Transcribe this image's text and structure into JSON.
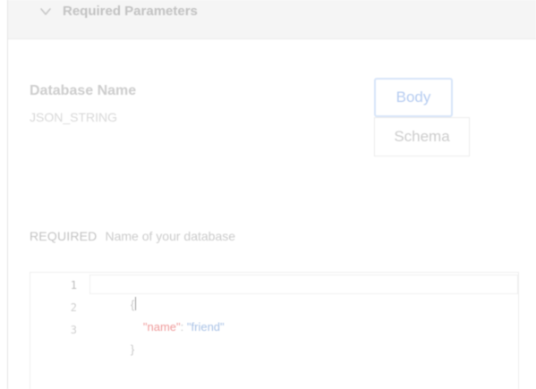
{
  "section": {
    "title": "Required Parameters",
    "expanded": true,
    "chevron_icon": "chevron-down-icon"
  },
  "parameter": {
    "name": "Database Name",
    "type": "JSON_STRING",
    "required_tag": "REQUIRED",
    "description": "Name of your database"
  },
  "tabs": [
    {
      "label": "Body",
      "active": true
    },
    {
      "label": "Schema",
      "active": false
    }
  ],
  "editor": {
    "line_numbers": [
      "1",
      "2",
      "3"
    ],
    "lines": [
      {
        "tokens": [
          {
            "type": "punc",
            "text": "{"
          }
        ]
      },
      {
        "tokens": [
          {
            "type": "key",
            "text": "\"name\""
          },
          {
            "type": "punc",
            "text": ": "
          },
          {
            "type": "str",
            "text": "\"friend\""
          }
        ]
      },
      {
        "tokens": [
          {
            "type": "punc",
            "text": "}"
          }
        ]
      }
    ]
  },
  "colors": {
    "accent": "#b6ccf1",
    "key": "#ef9a9a",
    "string": "#a9c2e6"
  }
}
